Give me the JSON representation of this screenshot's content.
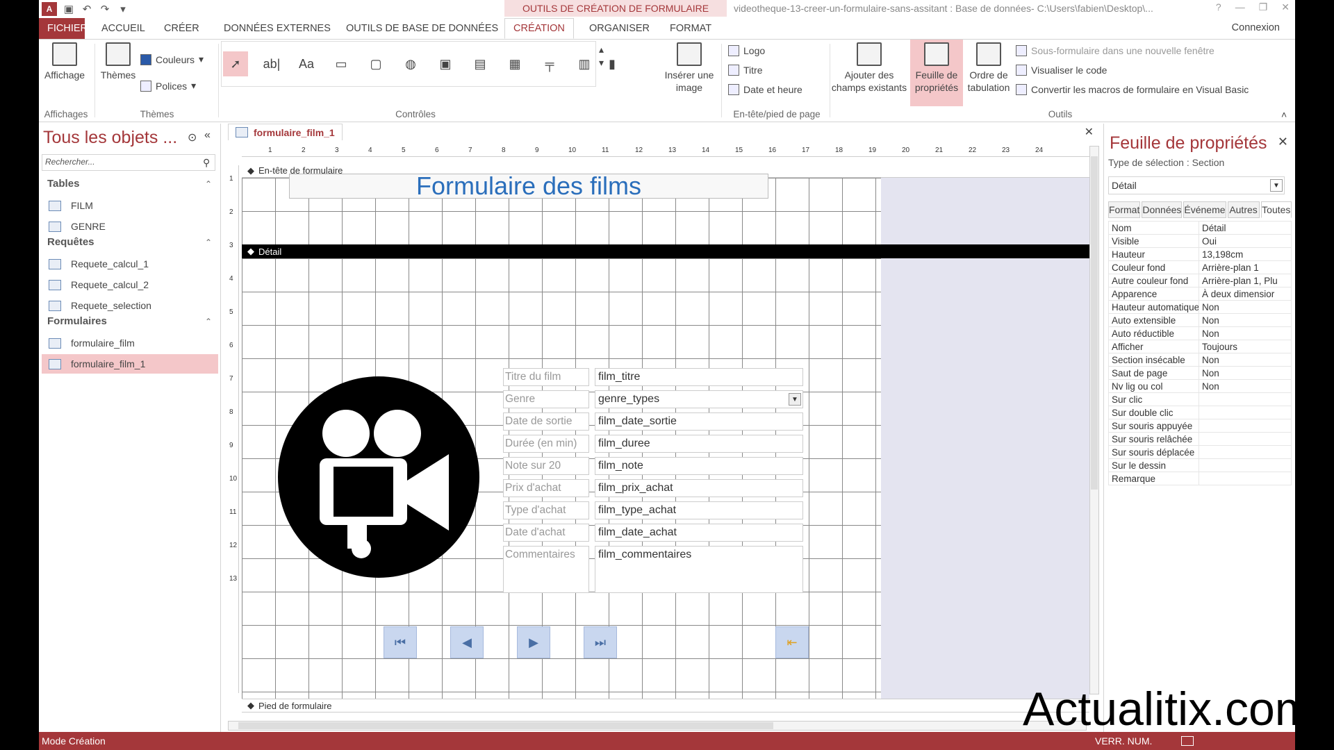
{
  "titlebar": {
    "context_title": "OUTILS DE CRÉATION DE FORMULAIRE",
    "doc_title": "videotheque-13-creer-un-formulaire-sans-assitant : Base de données- C:\\Users\\fabien\\Desktop\\...",
    "app_logo": "A"
  },
  "tabs": {
    "file": "FICHIER",
    "home": "ACCUEIL",
    "create": "CRÉER",
    "external": "DONNÉES EXTERNES",
    "dbtools": "OUTILS DE BASE DE DONNÉES",
    "design": "CRÉATION",
    "arrange": "ORGANISER",
    "format": "FORMAT",
    "connexion": "Connexion"
  },
  "ribbon": {
    "affichage": "Affichage",
    "affichages_group": "Affichages",
    "themes": "Thèmes",
    "couleurs": "Couleurs",
    "polices": "Polices",
    "themes_group": "Thèmes",
    "controles_group": "Contrôles",
    "inserer_image": "Insérer une image",
    "logo": "Logo",
    "titre": "Titre",
    "date_heure": "Date et heure",
    "entete_group": "En-tête/pied de page",
    "ajouter_champs": "Ajouter des champs existants",
    "feuille_props": "Feuille de propriétés",
    "ordre_tab": "Ordre de tabulation",
    "sous_formulaire": "Sous-formulaire dans une nouvelle fenêtre",
    "visualiser_code": "Visualiser le code",
    "convertir_macros": "Convertir les macros de formulaire en Visual Basic",
    "outils_group": "Outils"
  },
  "nav": {
    "title": "Tous les objets ...",
    "search_placeholder": "Rechercher...",
    "tables_header": "Tables",
    "tables": [
      "FILM",
      "GENRE"
    ],
    "queries_header": "Requêtes",
    "queries": [
      "Requete_calcul_1",
      "Requete_calcul_2",
      "Requete_selection"
    ],
    "forms_header": "Formulaires",
    "forms": [
      "formulaire_film",
      "formulaire_film_1"
    ]
  },
  "document": {
    "tab_label": "formulaire_film_1",
    "header_section": "En-tête de formulaire",
    "detail_section": "Détail",
    "footer_section": "Pied de formulaire",
    "form_title": "Formulaire des films",
    "fields": [
      {
        "label": "Titre du film",
        "value": "film_titre"
      },
      {
        "label": "Genre",
        "value": "genre_types"
      },
      {
        "label": "Date de sortie",
        "value": "film_date_sortie"
      },
      {
        "label": "Durée (en min)",
        "value": "film_duree"
      },
      {
        "label": "Note sur 20",
        "value": "film_note"
      },
      {
        "label": "Prix d'achat",
        "value": "film_prix_achat"
      },
      {
        "label": "Type d'achat",
        "value": "film_type_achat"
      },
      {
        "label": "Date d'achat",
        "value": "film_date_achat"
      },
      {
        "label": "Commentaires",
        "value": "film_commentaires"
      }
    ],
    "ruler_h": [
      "1",
      "2",
      "3",
      "4",
      "5",
      "6",
      "7",
      "8",
      "9",
      "10",
      "11",
      "12",
      "13",
      "14",
      "15",
      "16",
      "17",
      "18",
      "19",
      "20",
      "21",
      "22",
      "23",
      "24"
    ],
    "ruler_v": [
      "1",
      "2",
      "3",
      "4",
      "5",
      "6",
      "7",
      "8",
      "9",
      "10",
      "11",
      "12",
      "13"
    ]
  },
  "props": {
    "title": "Feuille de propriétés",
    "selection_type": "Type de sélection :  Section",
    "dropdown": "Détail",
    "tabs": [
      "Format",
      "Données",
      "Événeme",
      "Autres",
      "Toutes"
    ],
    "rows": [
      [
        "Nom",
        "Détail"
      ],
      [
        "Visible",
        "Oui"
      ],
      [
        "Hauteur",
        "13,198cm"
      ],
      [
        "Couleur fond",
        "Arrière-plan 1"
      ],
      [
        "Autre couleur fond",
        "Arrière-plan 1, Plu"
      ],
      [
        "Apparence",
        "À deux dimensior"
      ],
      [
        "Hauteur automatique",
        "Non"
      ],
      [
        "Auto extensible",
        "Non"
      ],
      [
        "Auto réductible",
        "Non"
      ],
      [
        "Afficher",
        "Toujours"
      ],
      [
        "Section insécable",
        "Non"
      ],
      [
        "Saut de page",
        "Non"
      ],
      [
        "Nv lig ou col",
        "Non"
      ],
      [
        "Sur clic",
        ""
      ],
      [
        "Sur double clic",
        ""
      ],
      [
        "Sur souris appuyée",
        ""
      ],
      [
        "Sur souris relâchée",
        ""
      ],
      [
        "Sur souris déplacée",
        ""
      ],
      [
        "Sur le dessin",
        ""
      ],
      [
        "Remarque",
        ""
      ]
    ]
  },
  "status": {
    "left": "Mode Création",
    "right": "VERR. NUM."
  },
  "watermark": "Actualitix.com",
  "colors": {
    "accent": "#a4373a",
    "title_blue": "#2a6ebb"
  }
}
